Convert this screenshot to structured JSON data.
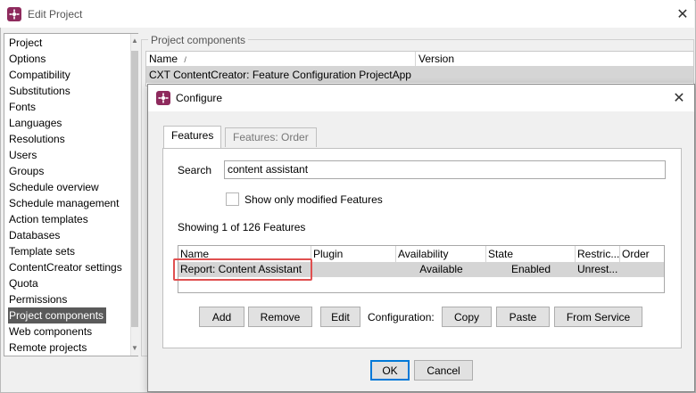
{
  "window": {
    "title": "Edit Project"
  },
  "sidebar": {
    "items": [
      {
        "label": "Project"
      },
      {
        "label": "Options"
      },
      {
        "label": "Compatibility"
      },
      {
        "label": "Substitutions"
      },
      {
        "label": "Fonts"
      },
      {
        "label": "Languages"
      },
      {
        "label": "Resolutions"
      },
      {
        "label": "Users"
      },
      {
        "label": "Groups"
      },
      {
        "label": "Schedule overview"
      },
      {
        "label": "Schedule management"
      },
      {
        "label": "Action templates"
      },
      {
        "label": "Databases"
      },
      {
        "label": "Template sets"
      },
      {
        "label": "ContentCreator settings"
      },
      {
        "label": "Quota"
      },
      {
        "label": "Permissions"
      },
      {
        "label": "Project components",
        "selected": true
      },
      {
        "label": "Web components"
      },
      {
        "label": "Remote projects"
      }
    ]
  },
  "project_components": {
    "legend": "Project components",
    "columns": [
      "Name",
      "Version"
    ],
    "sort_indicator": "/",
    "rows": [
      {
        "name": "CXT ContentCreator: Feature Configuration ProjectApp",
        "version": ""
      }
    ]
  },
  "dialog": {
    "title": "Configure",
    "tabs": [
      {
        "label": "Features",
        "active": true
      },
      {
        "label": "Features: Order",
        "active": false
      }
    ],
    "search": {
      "label": "Search",
      "value": "content assistant"
    },
    "modified_checkbox": {
      "label": "Show only modified Features",
      "checked": false
    },
    "count_text": "Showing 1 of 126 Features",
    "table": {
      "columns": [
        "Name",
        "Plugin",
        "Availability",
        "State",
        "Restric...",
        "Order"
      ],
      "rows": [
        {
          "name": "Report: Content Assistant",
          "plugin": "",
          "availability": "Available",
          "state": "Enabled",
          "restriction": "Unrest...",
          "order": ""
        }
      ]
    },
    "buttons": {
      "add": "Add",
      "remove": "Remove",
      "edit": "Edit",
      "config_label": "Configuration:",
      "copy": "Copy",
      "paste": "Paste",
      "from_service": "From Service",
      "ok": "OK",
      "cancel": "Cancel"
    }
  },
  "colors": {
    "brand_icon": "#8e2a5d",
    "selection": "#5a5a5a",
    "highlight_box": "#e05050",
    "default_button_border": "#0078d7"
  }
}
